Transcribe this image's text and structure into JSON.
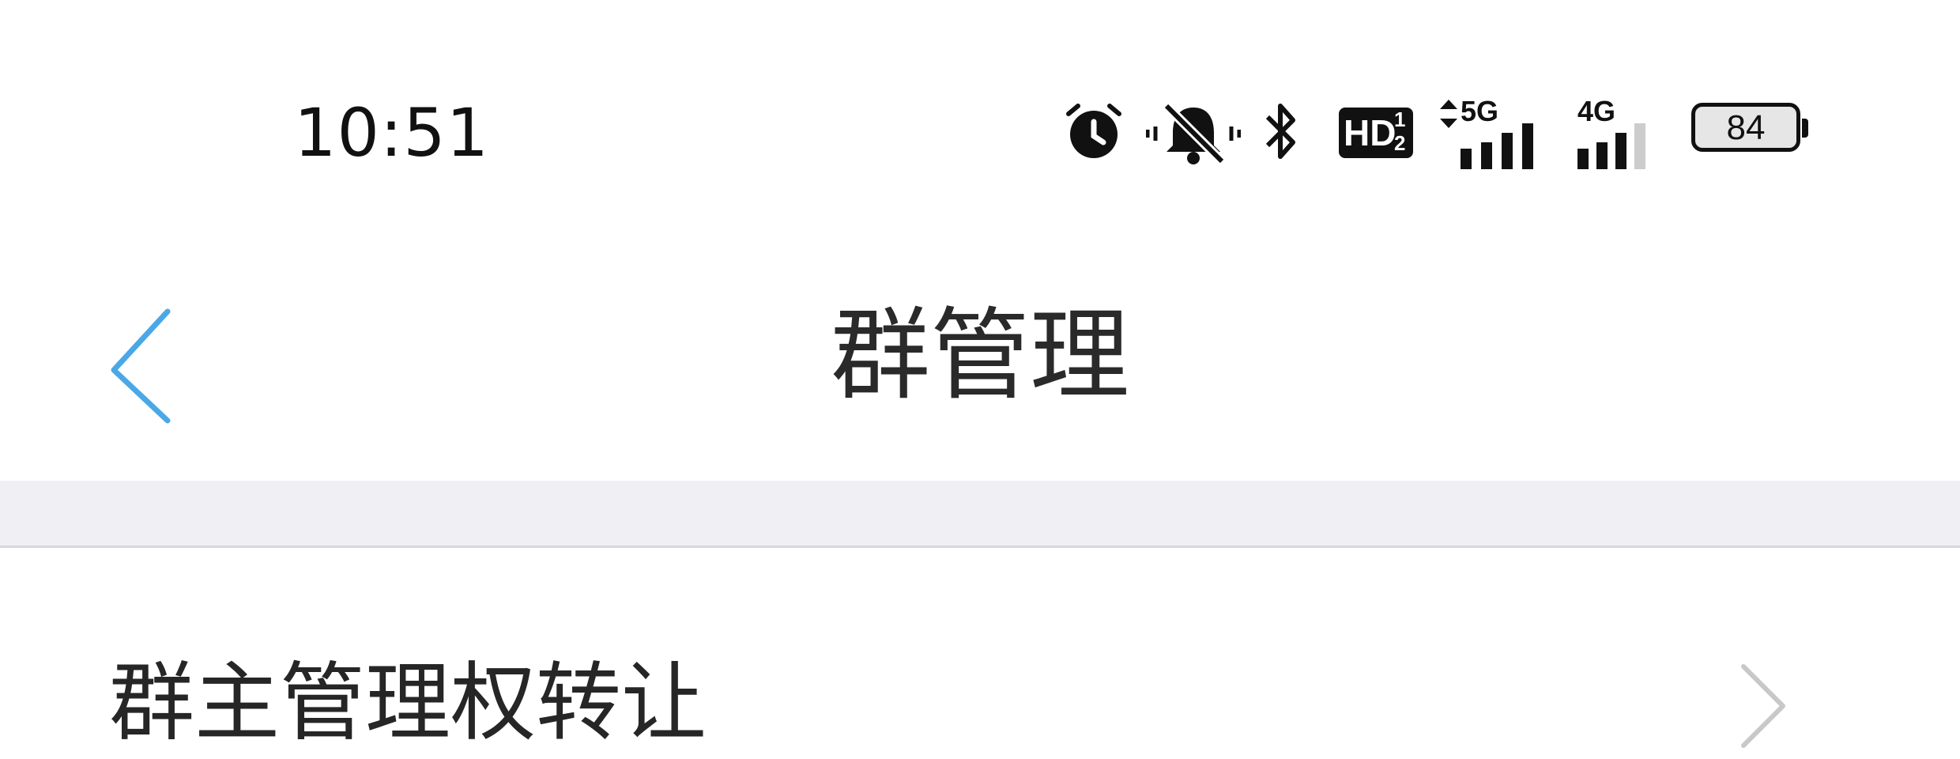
{
  "status_bar": {
    "time": "10:51",
    "icons": [
      "alarm-icon",
      "silent-bell-icon",
      "bluetooth-icon",
      "hd-icon",
      "5g-signal-icon",
      "4g-signal-icon",
      "battery-icon"
    ],
    "hd_label": "HD",
    "hd_sup": "1",
    "hd_sub": "2",
    "network_1": "5G",
    "network_2": "4G",
    "battery_level": "84"
  },
  "nav": {
    "title": "群管理",
    "back_icon": "chevron-left-icon",
    "accent_color": "#4aa8e6"
  },
  "list": {
    "items": [
      {
        "label": "群主管理权转让",
        "icon": "chevron-right-icon"
      }
    ]
  }
}
